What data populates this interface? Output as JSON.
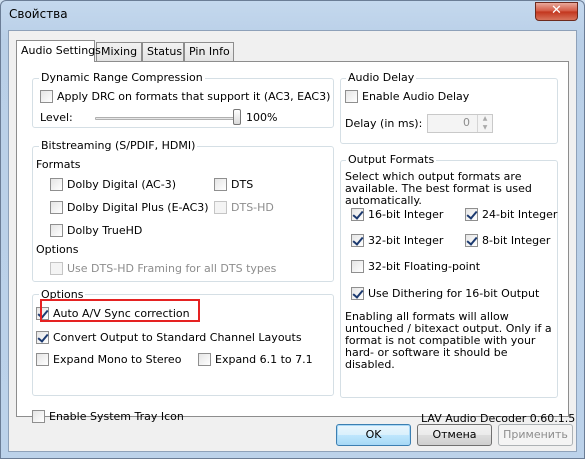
{
  "window": {
    "title": "Свойства"
  },
  "tabs": [
    "Audio Settings",
    "Mixing",
    "Status",
    "Pin Info"
  ],
  "drc": {
    "legend": "Dynamic Range Compression",
    "apply_label": "Apply DRC on formats that support it (AC3, EAC3)",
    "level_label": "Level:",
    "level_value": "100%",
    "level_fraction": 1.0
  },
  "bitstreaming": {
    "legend": "Bitstreaming (S/PDIF, HDMI)",
    "formats_label": "Formats",
    "dolby_digital": "Dolby Digital (AC-3)",
    "dts": "DTS",
    "dolby_digital_plus": "Dolby Digital Plus (E-AC3)",
    "dts_hd": "DTS-HD",
    "dolby_truehd": "Dolby TrueHD",
    "options_label": "Options",
    "dtshd_framing": "Use DTS-HD Framing for all DTS types"
  },
  "options": {
    "legend": "Options",
    "auto_sync": "Auto A/V Sync correction",
    "convert_output": "Convert Output to Standard Channel Layouts",
    "expand_mono": "Expand Mono to Stereo",
    "expand_61": "Expand 6.1 to 7.1"
  },
  "audio_delay": {
    "legend": "Audio Delay",
    "enable_label": "Enable Audio Delay",
    "delay_label": "Delay (in ms):",
    "delay_value": "0"
  },
  "output_formats": {
    "legend": "Output Formats",
    "description": "Select which output formats are available. The best format is used automatically.",
    "int16": "16-bit Integer",
    "int24": "24-bit Integer",
    "int32": "32-bit Integer",
    "int8": "8-bit Integer",
    "float32": "32-bit Floating-point",
    "dithering": "Use Dithering for 16-bit Output",
    "note": "Enabling all formats will allow untouched / bitexact output. Only if a format is not compatible with your hard- or software it should be disabled."
  },
  "footer": {
    "tray_icon": "Enable System Tray Icon",
    "version": "LAV Audio Decoder 0.60.1.5"
  },
  "buttons": {
    "ok": "OK",
    "cancel": "Отмена",
    "apply": "Применить"
  },
  "colors": {
    "highlight": "#e52222"
  }
}
